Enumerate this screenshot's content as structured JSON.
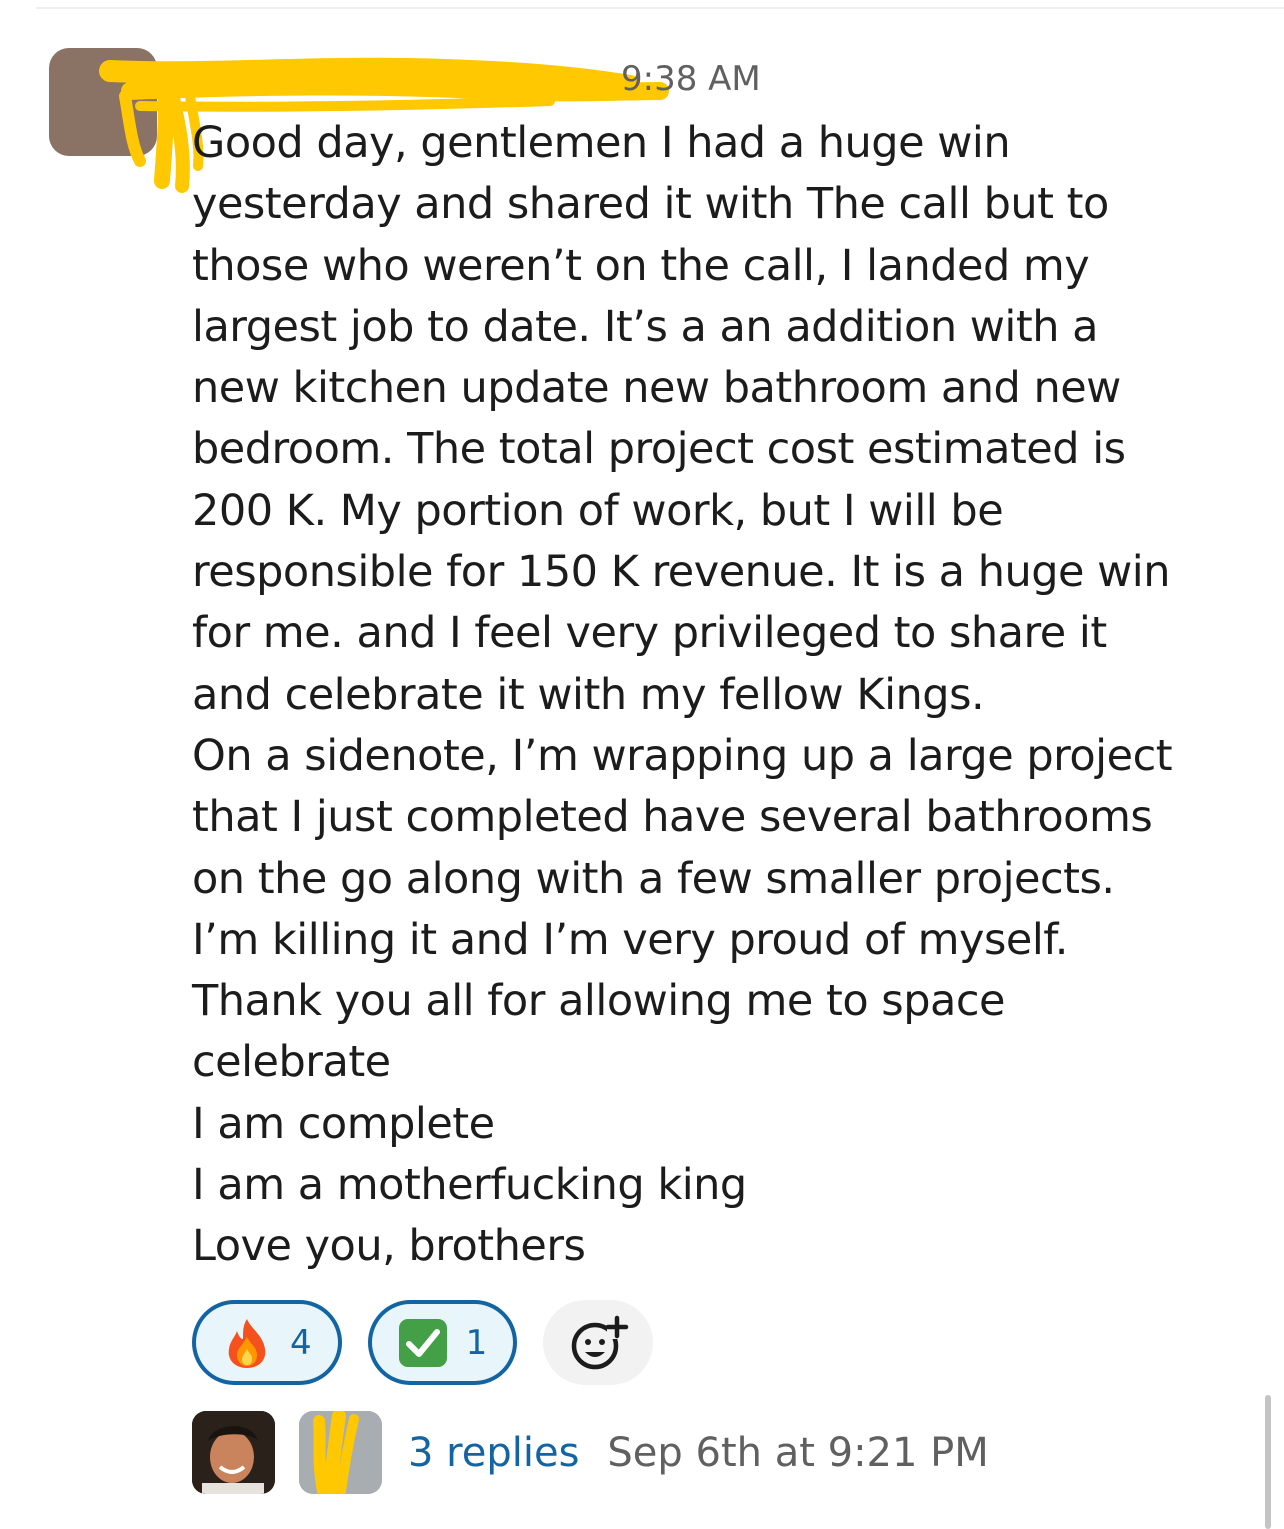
{
  "message": {
    "timestamp": "9:38 AM",
    "lines": [
      "Good day, gentlemen I had a huge win",
      "yesterday and shared it with The call but to",
      "those who weren’t on the call, I landed my",
      "largest job to date. It’s a an addition with a",
      "new kitchen update new bathroom and new",
      "bedroom. The total project cost estimated is",
      "200 K. My portion of work, but I will be",
      "responsible for 150 K revenue. It is a huge win",
      "for me. and I feel very privileged to share it",
      "and celebrate it with my fellow Kings.",
      "On a sidenote, I’m wrapping up a large project",
      "that I just completed have several bathrooms",
      "on the go along with a few smaller projects.",
      "I’m killing it and I’m very proud of myself.",
      "Thank you all for allowing me to space",
      "celebrate",
      "I am complete",
      "I am a motherfucking king",
      "Love you, brothers"
    ]
  },
  "reactions": [
    {
      "icon": "fire-emoji-icon",
      "count": "4"
    },
    {
      "icon": "check-mark-emoji-icon",
      "count": "1"
    }
  ],
  "add_reaction_icon": "add-reaction-icon",
  "thread": {
    "replies_label": "3 replies",
    "last_reply": "Sep 6th at 9:21 PM"
  },
  "colors": {
    "link": "#1264a3",
    "reaction_bg": "#e8f5fa",
    "muted_text": "#616061",
    "redaction": "#ffc800"
  }
}
